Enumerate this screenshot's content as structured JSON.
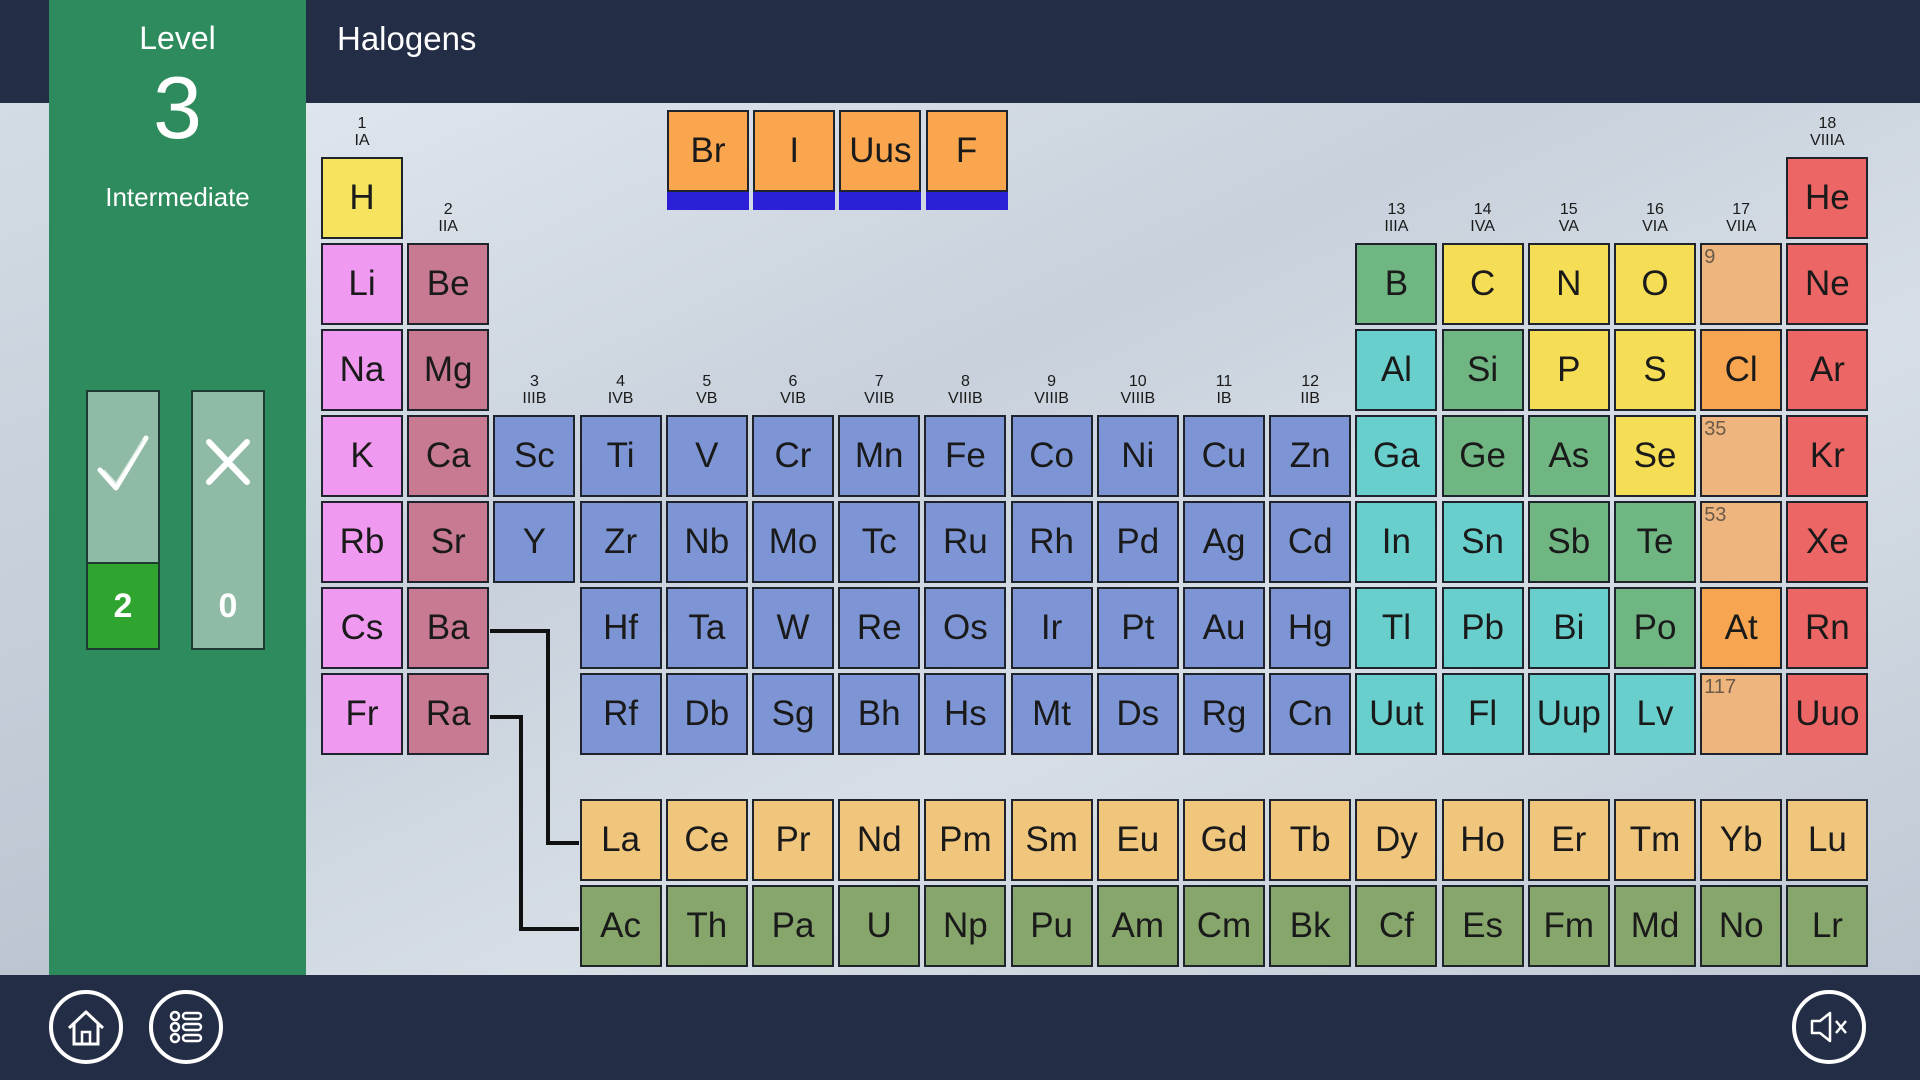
{
  "header": {
    "title": "Halogens"
  },
  "level": {
    "label": "Level",
    "number": "3",
    "difficulty": "Intermediate"
  },
  "score": {
    "correct": "2",
    "wrong": "0"
  },
  "answers": [
    {
      "symbol": "Br"
    },
    {
      "symbol": "I"
    },
    {
      "symbol": "Uus"
    },
    {
      "symbol": "F"
    }
  ],
  "group_headers": [
    {
      "n": "1",
      "r": "IA"
    },
    {
      "n": "2",
      "r": "IIA"
    },
    {
      "n": "3",
      "r": "IIIB"
    },
    {
      "n": "4",
      "r": "IVB"
    },
    {
      "n": "5",
      "r": "VB"
    },
    {
      "n": "6",
      "r": "VIB"
    },
    {
      "n": "7",
      "r": "VIIB"
    },
    {
      "n": "8",
      "r": "VIIIB"
    },
    {
      "n": "9",
      "r": "VIIIB"
    },
    {
      "n": "10",
      "r": "VIIIB"
    },
    {
      "n": "11",
      "r": "IB"
    },
    {
      "n": "12",
      "r": "IIB"
    },
    {
      "n": "13",
      "r": "IIIA"
    },
    {
      "n": "14",
      "r": "IVA"
    },
    {
      "n": "15",
      "r": "VA"
    },
    {
      "n": "16",
      "r": "VIA"
    },
    {
      "n": "17",
      "r": "VIIA"
    },
    {
      "n": "18",
      "r": "VIIIA"
    }
  ],
  "elements": [
    {
      "s": "H",
      "g": 1,
      "p": 1,
      "c": "c-h"
    },
    {
      "s": "He",
      "g": 18,
      "p": 1,
      "c": "c-noble"
    },
    {
      "s": "Li",
      "g": 1,
      "p": 2,
      "c": "c-alk"
    },
    {
      "s": "Be",
      "g": 2,
      "p": 2,
      "c": "c-ae"
    },
    {
      "s": "B",
      "g": 13,
      "p": 2,
      "c": "c-metl"
    },
    {
      "s": "C",
      "g": 14,
      "p": 2,
      "c": "c-nonm"
    },
    {
      "s": "N",
      "g": 15,
      "p": 2,
      "c": "c-nonm"
    },
    {
      "s": "O",
      "g": 16,
      "p": 2,
      "c": "c-nonm"
    },
    {
      "s": "",
      "g": 17,
      "p": 2,
      "c": "c-empty",
      "num": "9"
    },
    {
      "s": "Ne",
      "g": 18,
      "p": 2,
      "c": "c-noble"
    },
    {
      "s": "Na",
      "g": 1,
      "p": 3,
      "c": "c-alk"
    },
    {
      "s": "Mg",
      "g": 2,
      "p": 3,
      "c": "c-ae"
    },
    {
      "s": "Al",
      "g": 13,
      "p": 3,
      "c": "c-post"
    },
    {
      "s": "Si",
      "g": 14,
      "p": 3,
      "c": "c-metl"
    },
    {
      "s": "P",
      "g": 15,
      "p": 3,
      "c": "c-nonm"
    },
    {
      "s": "S",
      "g": 16,
      "p": 3,
      "c": "c-nonm"
    },
    {
      "s": "Cl",
      "g": 17,
      "p": 3,
      "c": "c-hal"
    },
    {
      "s": "Ar",
      "g": 18,
      "p": 3,
      "c": "c-noble"
    },
    {
      "s": "K",
      "g": 1,
      "p": 4,
      "c": "c-alk"
    },
    {
      "s": "Ca",
      "g": 2,
      "p": 4,
      "c": "c-ae"
    },
    {
      "s": "Sc",
      "g": 3,
      "p": 4,
      "c": "c-tm"
    },
    {
      "s": "Ti",
      "g": 4,
      "p": 4,
      "c": "c-tm"
    },
    {
      "s": "V",
      "g": 5,
      "p": 4,
      "c": "c-tm"
    },
    {
      "s": "Cr",
      "g": 6,
      "p": 4,
      "c": "c-tm"
    },
    {
      "s": "Mn",
      "g": 7,
      "p": 4,
      "c": "c-tm"
    },
    {
      "s": "Fe",
      "g": 8,
      "p": 4,
      "c": "c-tm"
    },
    {
      "s": "Co",
      "g": 9,
      "p": 4,
      "c": "c-tm"
    },
    {
      "s": "Ni",
      "g": 10,
      "p": 4,
      "c": "c-tm"
    },
    {
      "s": "Cu",
      "g": 11,
      "p": 4,
      "c": "c-tm"
    },
    {
      "s": "Zn",
      "g": 12,
      "p": 4,
      "c": "c-tm"
    },
    {
      "s": "Ga",
      "g": 13,
      "p": 4,
      "c": "c-post"
    },
    {
      "s": "Ge",
      "g": 14,
      "p": 4,
      "c": "c-metl"
    },
    {
      "s": "As",
      "g": 15,
      "p": 4,
      "c": "c-metl"
    },
    {
      "s": "Se",
      "g": 16,
      "p": 4,
      "c": "c-nonm"
    },
    {
      "s": "",
      "g": 17,
      "p": 4,
      "c": "c-empty",
      "num": "35"
    },
    {
      "s": "Kr",
      "g": 18,
      "p": 4,
      "c": "c-noble"
    },
    {
      "s": "Rb",
      "g": 1,
      "p": 5,
      "c": "c-alk"
    },
    {
      "s": "Sr",
      "g": 2,
      "p": 5,
      "c": "c-ae"
    },
    {
      "s": "Y",
      "g": 3,
      "p": 5,
      "c": "c-tm"
    },
    {
      "s": "Zr",
      "g": 4,
      "p": 5,
      "c": "c-tm"
    },
    {
      "s": "Nb",
      "g": 5,
      "p": 5,
      "c": "c-tm"
    },
    {
      "s": "Mo",
      "g": 6,
      "p": 5,
      "c": "c-tm"
    },
    {
      "s": "Tc",
      "g": 7,
      "p": 5,
      "c": "c-tm"
    },
    {
      "s": "Ru",
      "g": 8,
      "p": 5,
      "c": "c-tm"
    },
    {
      "s": "Rh",
      "g": 9,
      "p": 5,
      "c": "c-tm"
    },
    {
      "s": "Pd",
      "g": 10,
      "p": 5,
      "c": "c-tm"
    },
    {
      "s": "Ag",
      "g": 11,
      "p": 5,
      "c": "c-tm"
    },
    {
      "s": "Cd",
      "g": 12,
      "p": 5,
      "c": "c-tm"
    },
    {
      "s": "In",
      "g": 13,
      "p": 5,
      "c": "c-post"
    },
    {
      "s": "Sn",
      "g": 14,
      "p": 5,
      "c": "c-post"
    },
    {
      "s": "Sb",
      "g": 15,
      "p": 5,
      "c": "c-metl"
    },
    {
      "s": "Te",
      "g": 16,
      "p": 5,
      "c": "c-metl"
    },
    {
      "s": "",
      "g": 17,
      "p": 5,
      "c": "c-empty",
      "num": "53"
    },
    {
      "s": "Xe",
      "g": 18,
      "p": 5,
      "c": "c-noble"
    },
    {
      "s": "Cs",
      "g": 1,
      "p": 6,
      "c": "c-alk"
    },
    {
      "s": "Ba",
      "g": 2,
      "p": 6,
      "c": "c-ae"
    },
    {
      "s": "Hf",
      "g": 4,
      "p": 6,
      "c": "c-tm"
    },
    {
      "s": "Ta",
      "g": 5,
      "p": 6,
      "c": "c-tm"
    },
    {
      "s": "W",
      "g": 6,
      "p": 6,
      "c": "c-tm"
    },
    {
      "s": "Re",
      "g": 7,
      "p": 6,
      "c": "c-tm"
    },
    {
      "s": "Os",
      "g": 8,
      "p": 6,
      "c": "c-tm"
    },
    {
      "s": "Ir",
      "g": 9,
      "p": 6,
      "c": "c-tm"
    },
    {
      "s": "Pt",
      "g": 10,
      "p": 6,
      "c": "c-tm"
    },
    {
      "s": "Au",
      "g": 11,
      "p": 6,
      "c": "c-tm"
    },
    {
      "s": "Hg",
      "g": 12,
      "p": 6,
      "c": "c-tm"
    },
    {
      "s": "Tl",
      "g": 13,
      "p": 6,
      "c": "c-post"
    },
    {
      "s": "Pb",
      "g": 14,
      "p": 6,
      "c": "c-post"
    },
    {
      "s": "Bi",
      "g": 15,
      "p": 6,
      "c": "c-post"
    },
    {
      "s": "Po",
      "g": 16,
      "p": 6,
      "c": "c-metl"
    },
    {
      "s": "At",
      "g": 17,
      "p": 6,
      "c": "c-hal"
    },
    {
      "s": "Rn",
      "g": 18,
      "p": 6,
      "c": "c-noble"
    },
    {
      "s": "Fr",
      "g": 1,
      "p": 7,
      "c": "c-alk"
    },
    {
      "s": "Ra",
      "g": 2,
      "p": 7,
      "c": "c-ae"
    },
    {
      "s": "Rf",
      "g": 4,
      "p": 7,
      "c": "c-tm"
    },
    {
      "s": "Db",
      "g": 5,
      "p": 7,
      "c": "c-tm"
    },
    {
      "s": "Sg",
      "g": 6,
      "p": 7,
      "c": "c-tm"
    },
    {
      "s": "Bh",
      "g": 7,
      "p": 7,
      "c": "c-tm"
    },
    {
      "s": "Hs",
      "g": 8,
      "p": 7,
      "c": "c-tm"
    },
    {
      "s": "Mt",
      "g": 9,
      "p": 7,
      "c": "c-tm"
    },
    {
      "s": "Ds",
      "g": 10,
      "p": 7,
      "c": "c-tm"
    },
    {
      "s": "Rg",
      "g": 11,
      "p": 7,
      "c": "c-tm"
    },
    {
      "s": "Cn",
      "g": 12,
      "p": 7,
      "c": "c-tm"
    },
    {
      "s": "Uut",
      "g": 13,
      "p": 7,
      "c": "c-post"
    },
    {
      "s": "Fl",
      "g": 14,
      "p": 7,
      "c": "c-post"
    },
    {
      "s": "Uup",
      "g": 15,
      "p": 7,
      "c": "c-post"
    },
    {
      "s": "Lv",
      "g": 16,
      "p": 7,
      "c": "c-post"
    },
    {
      "s": "",
      "g": 17,
      "p": 7,
      "c": "c-empty",
      "num": "117"
    },
    {
      "s": "Uuo",
      "g": 18,
      "p": 7,
      "c": "c-noble"
    }
  ],
  "lanthanides": [
    "La",
    "Ce",
    "Pr",
    "Nd",
    "Pm",
    "Sm",
    "Eu",
    "Gd",
    "Tb",
    "Dy",
    "Ho",
    "Er",
    "Tm",
    "Yb",
    "Lu"
  ],
  "actinides": [
    "Ac",
    "Th",
    "Pa",
    "U",
    "Np",
    "Pu",
    "Am",
    "Cm",
    "Bk",
    "Cf",
    "Es",
    "Fm",
    "Md",
    "No",
    "Lr"
  ],
  "icons": {
    "check": "check-icon",
    "cross": "cross-icon",
    "home": "home-icon",
    "menu": "list-menu-icon",
    "sound": "sound-muted-icon"
  },
  "colors": {
    "topbar": "#232d45",
    "panel": "#2e8b5d",
    "correct": "#2fa52f",
    "answer_bar": "#2c1fd8",
    "halogen": "#f7a550"
  }
}
